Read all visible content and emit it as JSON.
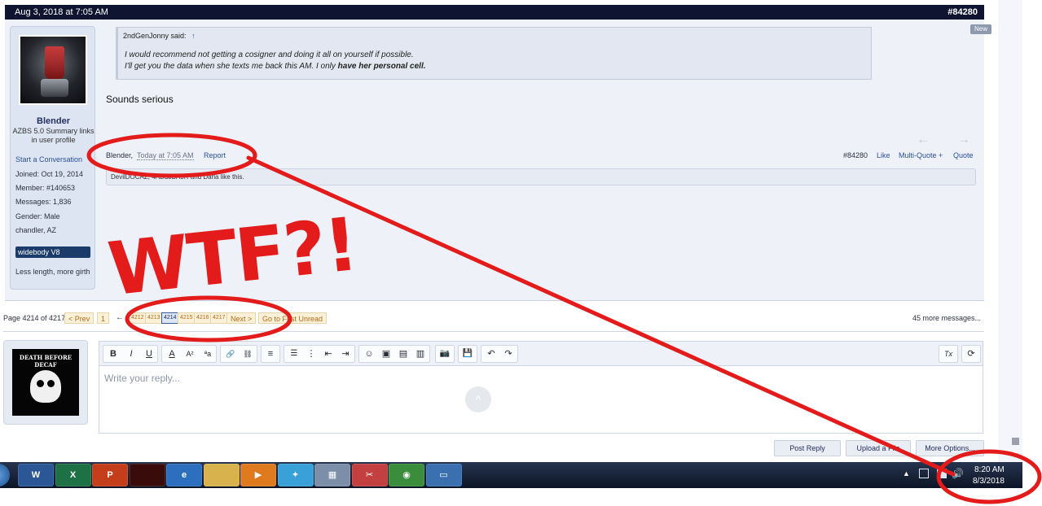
{
  "post": {
    "date": "Aug 3, 2018 at 7:05 AM",
    "number": "#84280",
    "new_badge": "New",
    "quote": {
      "author": "2ndGenJonny said:",
      "arrow": "↑",
      "line1": "I would recommend not getting a cosigner and doing it all on yourself if possible.",
      "line2_prefix": "I'll get you the data when she texts me back this AM. I only ",
      "line2_bold": "have her personal cell."
    },
    "message": "Sounds serious",
    "footer": {
      "author": "Blender,",
      "time": "Today at 7:05 AM",
      "report": "Report",
      "number": "#84280",
      "like": "Like",
      "multiquote": "Multi-Quote +",
      "quote": "Quote"
    },
    "likes": "DevilDOCAZ, 4ABSJBA9R and Darla like this."
  },
  "user": {
    "name": "Blender",
    "title": "AZBS 5.0 Summary links in user profile",
    "start_conversation": "Start a Conversation",
    "joined": "Joined:  Oct 19, 2014",
    "member": "Member:  #140653",
    "messages": "Messages:  1,836",
    "gender": "Gender:  Male",
    "location": "chandler, AZ",
    "badge": "widebody V8",
    "signature": "Less length, more girth"
  },
  "pagination": {
    "label": "Page 4214 of 4217",
    "prev": "< Prev",
    "first": "1",
    "dash": "←",
    "pages": [
      "4212",
      "4213",
      "4214",
      "4215",
      "4216",
      "4217"
    ],
    "next": "Next >",
    "first_unread": "Go to First Unread",
    "more_messages": "45 more messages..."
  },
  "editor": {
    "my_avatar_text": "DEATH BEFORE DECAF",
    "placeholder": "Write your reply...",
    "toolbar": {
      "bold": "B",
      "italic": "I",
      "underline": "U",
      "font_color": "A",
      "font_size": "A²",
      "font_family": "ªa",
      "link": "🔗",
      "unlink": "⛓",
      "align": "≡",
      "bullets": "☰",
      "numbers": "⋮",
      "outdent": "⇤",
      "indent": "⇥",
      "smilie": "☺",
      "image": "▣",
      "media": "▤",
      "quote": "▥",
      "camera": "📷",
      "save": "💾",
      "undo": "↶",
      "redo": "↷",
      "remove_format": "Tx",
      "preview": "⟳"
    },
    "scroll_top": "^",
    "post_reply": "Post Reply",
    "upload_file": "Upload a File",
    "more_options": "More Options..."
  },
  "taskbar": {
    "apps": [
      {
        "name": "word",
        "label": "W",
        "color": "#2b5797"
      },
      {
        "name": "excel",
        "label": "X",
        "color": "#1e7145"
      },
      {
        "name": "powerpoint",
        "label": "P",
        "color": "#c43e1c"
      },
      {
        "name": "game",
        "label": "",
        "color": "#3a0b0b"
      },
      {
        "name": "internet-explorer",
        "label": "e",
        "color": "#2d6fbf"
      },
      {
        "name": "file-explorer",
        "label": "",
        "color": "#d8b24d"
      },
      {
        "name": "media-player",
        "label": "▶",
        "color": "#e07a1e"
      },
      {
        "name": "network",
        "label": "✦",
        "color": "#3aa0d8"
      },
      {
        "name": "calculator",
        "label": "▦",
        "color": "#7d8fa8"
      },
      {
        "name": "snipping-tool",
        "label": "✂",
        "color": "#c24040"
      },
      {
        "name": "chrome",
        "label": "◉",
        "color": "#3a8d3a"
      },
      {
        "name": "photo-viewer",
        "label": "▭",
        "color": "#3a6fb0"
      }
    ],
    "clock_time": "8:20 AM",
    "clock_date": "8/3/2018"
  },
  "annotation": {
    "text": "WTF?!"
  },
  "colors": {
    "header": "#0f1530",
    "annotation_red": "#e31b1b",
    "link_blue": "#2b4fa0"
  }
}
